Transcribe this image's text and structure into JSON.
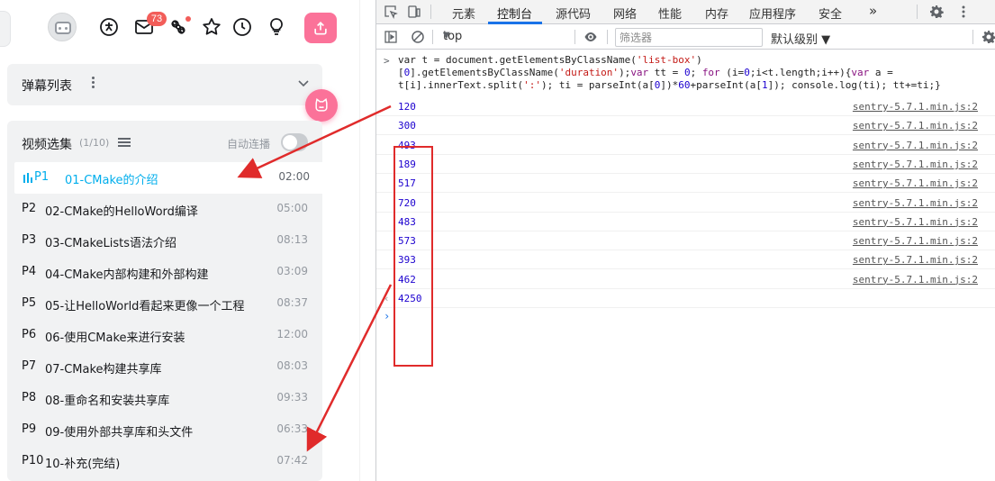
{
  "header": {
    "message_badge": "73",
    "icons": [
      "avatar",
      "big-member-icon",
      "message-icon",
      "dynamic-icon",
      "favorite-icon",
      "history-icon",
      "creative-icon",
      "upload-icon"
    ]
  },
  "danmu": {
    "title": "弹幕列表"
  },
  "playlist": {
    "title": "视频选集",
    "count": "(1/10)",
    "autoplay_label": "自动连播",
    "items": [
      {
        "num": "P1",
        "name": "01-CMake的介绍",
        "duration": "02:00",
        "active": true
      },
      {
        "num": "P2",
        "name": "02-CMake的HelloWord编译",
        "duration": "05:00"
      },
      {
        "num": "P3",
        "name": "03-CMakeLists语法介绍",
        "duration": "08:13"
      },
      {
        "num": "P4",
        "name": "04-CMake内部构建和外部构建",
        "duration": "03:09"
      },
      {
        "num": "P5",
        "name": "05-让HelloWorld看起来更像一个工程",
        "duration": "08:37"
      },
      {
        "num": "P6",
        "name": "06-使用CMake来进行安装",
        "duration": "12:00"
      },
      {
        "num": "P7",
        "name": "07-CMake构建共享库",
        "duration": "08:03"
      },
      {
        "num": "P8",
        "name": "08-重命名和安装共享库",
        "duration": "09:33"
      },
      {
        "num": "P9",
        "name": "09-使用外部共享库和头文件",
        "duration": "06:33"
      },
      {
        "num": "P10",
        "name": "10-补充(完结)",
        "duration": "07:42"
      }
    ]
  },
  "devtools": {
    "tabs": [
      "元素",
      "控制台",
      "源代码",
      "网络",
      "性能",
      "内存",
      "应用程序",
      "安全"
    ],
    "active_tab": "控制台",
    "more_tabs": "»",
    "context": "top",
    "filter_placeholder": "筛选器",
    "levels": "默认级别 ▼",
    "command": {
      "p1": "var t = document.getElementsByClassName(",
      "s1": "'list-box'",
      "p2": ")\n[",
      "n1": "0",
      "p3": "].getElementsByClassName(",
      "s2": "'duration'",
      "p4": ");",
      "k1": "var",
      "p5": " tt = ",
      "n2": "0",
      "p6": "; ",
      "k2": "for",
      "p7": " (i=",
      "n3": "0",
      "p8": ";i<t.length;i++){",
      "k3": "var",
      "p9": " a =\nt[i].innerText.split(",
      "s3": "':'",
      "p10": "); ti = parseInt(a[",
      "n4": "0",
      "p11": "])*",
      "n5": "60",
      "p12": "+parseInt(a[",
      "n6": "1",
      "p13": "]); console.log(ti); tt+=ti;}"
    },
    "logs": [
      {
        "value": "120",
        "source": "sentry-5.7.1.min.js:2"
      },
      {
        "value": "300",
        "source": "sentry-5.7.1.min.js:2"
      },
      {
        "value": "493",
        "source": "sentry-5.7.1.min.js:2"
      },
      {
        "value": "189",
        "source": "sentry-5.7.1.min.js:2"
      },
      {
        "value": "517",
        "source": "sentry-5.7.1.min.js:2"
      },
      {
        "value": "720",
        "source": "sentry-5.7.1.min.js:2"
      },
      {
        "value": "483",
        "source": "sentry-5.7.1.min.js:2"
      },
      {
        "value": "573",
        "source": "sentry-5.7.1.min.js:2"
      },
      {
        "value": "393",
        "source": "sentry-5.7.1.min.js:2"
      },
      {
        "value": "462",
        "source": "sentry-5.7.1.min.js:2"
      }
    ],
    "result": "4250"
  },
  "colors": {
    "accent": "#00aeec",
    "pink": "#fb7299",
    "annotation": "#e02b2b",
    "devtools_blue": "#1a73e8"
  }
}
